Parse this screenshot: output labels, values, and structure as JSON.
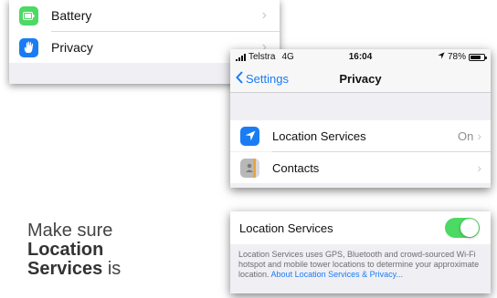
{
  "panel1": {
    "battery_label": "Battery",
    "privacy_label": "Privacy",
    "battery_icon_color": "#4cd964",
    "privacy_icon_color": "#1a7cf5"
  },
  "status_bar": {
    "carrier": "Telstra",
    "network": "4G",
    "time": "16:04",
    "battery_percent": "78%",
    "battery_level": 0.78
  },
  "navbar": {
    "back_label": "Settings",
    "title": "Privacy"
  },
  "privacy_list": [
    {
      "label": "Location Services",
      "value": "On",
      "icon": "location-arrow-icon"
    },
    {
      "label": "Contacts",
      "value": "",
      "icon": "contacts-icon"
    }
  ],
  "location_panel": {
    "label": "Location Services",
    "toggle_on": true,
    "footer_text": "Location Services uses GPS, Bluetooth and crowd-sourced Wi-Fi hotspot and mobile tower locations to determine your approximate location.",
    "footer_link": "About Location Services & Privacy..."
  },
  "instruction": {
    "part1": "Make sure",
    "part2": "Location Services",
    "part3": "is"
  },
  "colors": {
    "accent": "#1a7cf5",
    "toggle_on": "#4cd964",
    "background_gray": "#efeff4"
  }
}
